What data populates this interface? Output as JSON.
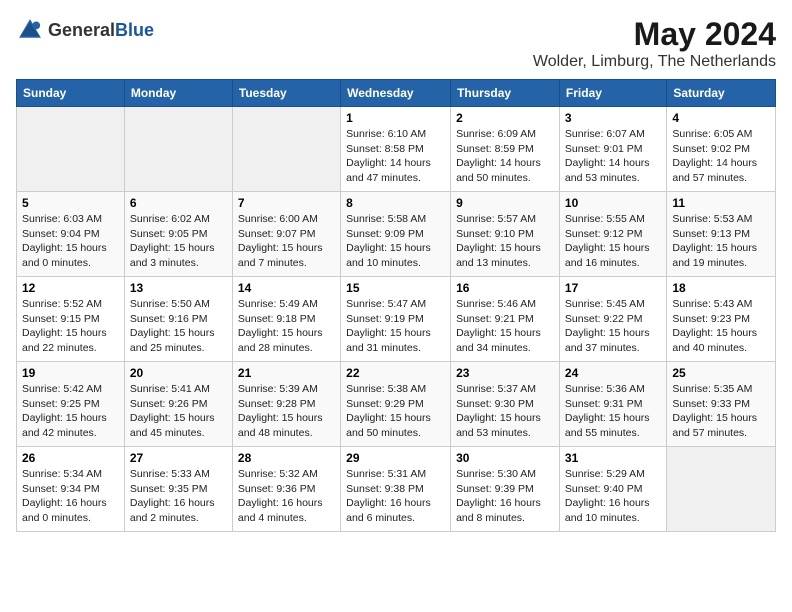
{
  "header": {
    "logo_general": "General",
    "logo_blue": "Blue",
    "title": "May 2024",
    "subtitle": "Wolder, Limburg, The Netherlands"
  },
  "days_of_week": [
    "Sunday",
    "Monday",
    "Tuesday",
    "Wednesday",
    "Thursday",
    "Friday",
    "Saturday"
  ],
  "weeks": [
    {
      "days": [
        {
          "num": "",
          "info": ""
        },
        {
          "num": "",
          "info": ""
        },
        {
          "num": "",
          "info": ""
        },
        {
          "num": "1",
          "sunrise": "6:10 AM",
          "sunset": "8:58 PM",
          "daylight": "14 hours and 47 minutes."
        },
        {
          "num": "2",
          "sunrise": "6:09 AM",
          "sunset": "8:59 PM",
          "daylight": "14 hours and 50 minutes."
        },
        {
          "num": "3",
          "sunrise": "6:07 AM",
          "sunset": "9:01 PM",
          "daylight": "14 hours and 53 minutes."
        },
        {
          "num": "4",
          "sunrise": "6:05 AM",
          "sunset": "9:02 PM",
          "daylight": "14 hours and 57 minutes."
        }
      ]
    },
    {
      "days": [
        {
          "num": "5",
          "sunrise": "6:03 AM",
          "sunset": "9:04 PM",
          "daylight": "15 hours and 0 minutes."
        },
        {
          "num": "6",
          "sunrise": "6:02 AM",
          "sunset": "9:05 PM",
          "daylight": "15 hours and 3 minutes."
        },
        {
          "num": "7",
          "sunrise": "6:00 AM",
          "sunset": "9:07 PM",
          "daylight": "15 hours and 7 minutes."
        },
        {
          "num": "8",
          "sunrise": "5:58 AM",
          "sunset": "9:09 PM",
          "daylight": "15 hours and 10 minutes."
        },
        {
          "num": "9",
          "sunrise": "5:57 AM",
          "sunset": "9:10 PM",
          "daylight": "15 hours and 13 minutes."
        },
        {
          "num": "10",
          "sunrise": "5:55 AM",
          "sunset": "9:12 PM",
          "daylight": "15 hours and 16 minutes."
        },
        {
          "num": "11",
          "sunrise": "5:53 AM",
          "sunset": "9:13 PM",
          "daylight": "15 hours and 19 minutes."
        }
      ]
    },
    {
      "days": [
        {
          "num": "12",
          "sunrise": "5:52 AM",
          "sunset": "9:15 PM",
          "daylight": "15 hours and 22 minutes."
        },
        {
          "num": "13",
          "sunrise": "5:50 AM",
          "sunset": "9:16 PM",
          "daylight": "15 hours and 25 minutes."
        },
        {
          "num": "14",
          "sunrise": "5:49 AM",
          "sunset": "9:18 PM",
          "daylight": "15 hours and 28 minutes."
        },
        {
          "num": "15",
          "sunrise": "5:47 AM",
          "sunset": "9:19 PM",
          "daylight": "15 hours and 31 minutes."
        },
        {
          "num": "16",
          "sunrise": "5:46 AM",
          "sunset": "9:21 PM",
          "daylight": "15 hours and 34 minutes."
        },
        {
          "num": "17",
          "sunrise": "5:45 AM",
          "sunset": "9:22 PM",
          "daylight": "15 hours and 37 minutes."
        },
        {
          "num": "18",
          "sunrise": "5:43 AM",
          "sunset": "9:23 PM",
          "daylight": "15 hours and 40 minutes."
        }
      ]
    },
    {
      "days": [
        {
          "num": "19",
          "sunrise": "5:42 AM",
          "sunset": "9:25 PM",
          "daylight": "15 hours and 42 minutes."
        },
        {
          "num": "20",
          "sunrise": "5:41 AM",
          "sunset": "9:26 PM",
          "daylight": "15 hours and 45 minutes."
        },
        {
          "num": "21",
          "sunrise": "5:39 AM",
          "sunset": "9:28 PM",
          "daylight": "15 hours and 48 minutes."
        },
        {
          "num": "22",
          "sunrise": "5:38 AM",
          "sunset": "9:29 PM",
          "daylight": "15 hours and 50 minutes."
        },
        {
          "num": "23",
          "sunrise": "5:37 AM",
          "sunset": "9:30 PM",
          "daylight": "15 hours and 53 minutes."
        },
        {
          "num": "24",
          "sunrise": "5:36 AM",
          "sunset": "9:31 PM",
          "daylight": "15 hours and 55 minutes."
        },
        {
          "num": "25",
          "sunrise": "5:35 AM",
          "sunset": "9:33 PM",
          "daylight": "15 hours and 57 minutes."
        }
      ]
    },
    {
      "days": [
        {
          "num": "26",
          "sunrise": "5:34 AM",
          "sunset": "9:34 PM",
          "daylight": "16 hours and 0 minutes."
        },
        {
          "num": "27",
          "sunrise": "5:33 AM",
          "sunset": "9:35 PM",
          "daylight": "16 hours and 2 minutes."
        },
        {
          "num": "28",
          "sunrise": "5:32 AM",
          "sunset": "9:36 PM",
          "daylight": "16 hours and 4 minutes."
        },
        {
          "num": "29",
          "sunrise": "5:31 AM",
          "sunset": "9:38 PM",
          "daylight": "16 hours and 6 minutes."
        },
        {
          "num": "30",
          "sunrise": "5:30 AM",
          "sunset": "9:39 PM",
          "daylight": "16 hours and 8 minutes."
        },
        {
          "num": "31",
          "sunrise": "5:29 AM",
          "sunset": "9:40 PM",
          "daylight": "16 hours and 10 minutes."
        },
        {
          "num": "",
          "info": ""
        }
      ]
    }
  ],
  "labels": {
    "sunrise": "Sunrise:",
    "sunset": "Sunset:",
    "daylight": "Daylight:"
  }
}
